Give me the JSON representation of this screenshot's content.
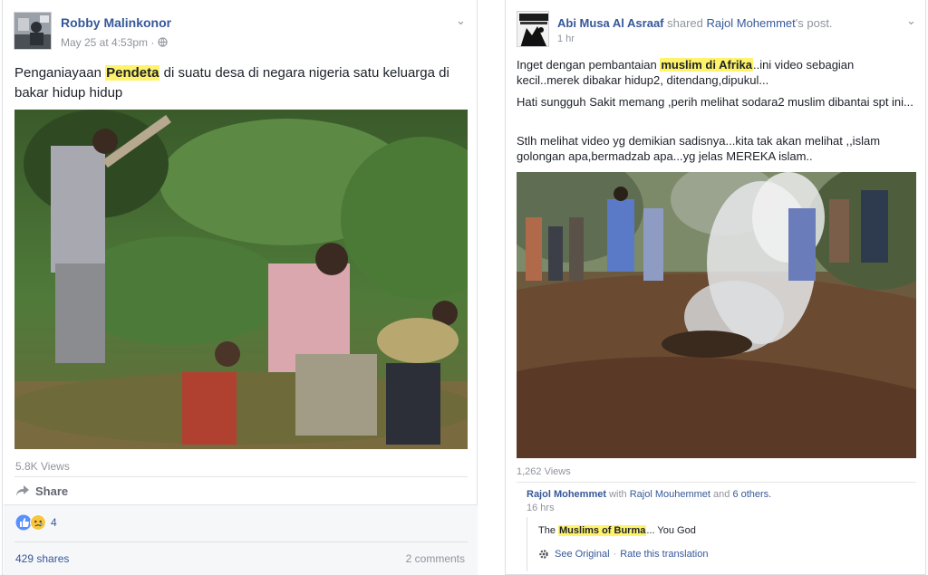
{
  "left_post": {
    "author": "Robby Malinkonor",
    "timestamp": "May 25 at 4:53pm",
    "separator": "·",
    "privacy_icon": "globe-icon",
    "text_before": "Penganiayaan ",
    "text_highlight": "Pendeta",
    "text_after": " di suatu desa di negara nigeria satu keluarga di bakar hidup hidup",
    "views": "5.8K Views",
    "share_label": "Share",
    "share_icon": "share-arrow-icon",
    "reaction_icons": [
      "like-icon",
      "sad-icon"
    ],
    "reaction_count": "4",
    "shares": "429 shares",
    "comments": "2 comments"
  },
  "right_post": {
    "author": "Abi Musa Al Asraaf",
    "shared_text": " shared ",
    "shared_from": "Rajol Mohemmet",
    "shared_suffix": "'s post.",
    "time": "1 hr",
    "para1_before": "Inget dengan pembantaian ",
    "para1_highlight": "muslim di Afrika",
    "para1_after": "..ini video sebagian kecil..merek dibakar hidup2, ditendang,dipukul...",
    "para2": "Hati sungguh Sakit memang ,perih melihat sodara2 muslim dibantai spt ini...",
    "para3": "Stlh melihat video yg demikian sadisnya...kita tak akan melihat ,,islam golongan apa,bermadzab apa...yg jelas MEREKA islam..",
    "views": "1,262 Views",
    "original": {
      "author": "Rajol Mohemmet",
      "with_text": " with ",
      "tagged": "Rajol Mouhemmet",
      "and_text": " and ",
      "others": "6 others.",
      "time": "16 hrs",
      "comment_before": "The ",
      "comment_highlight": "Muslims of Burma",
      "comment_after": "... You God",
      "see_original": "See Original",
      "separator": "·",
      "rate_translation": "Rate this translation",
      "gear_icon": "gear-icon"
    }
  },
  "colors": {
    "link": "#365899",
    "meta": "#90949c",
    "highlight": "#fff36b",
    "like_blue": "#5890ff",
    "sad_yellow": "#f7c63e"
  }
}
